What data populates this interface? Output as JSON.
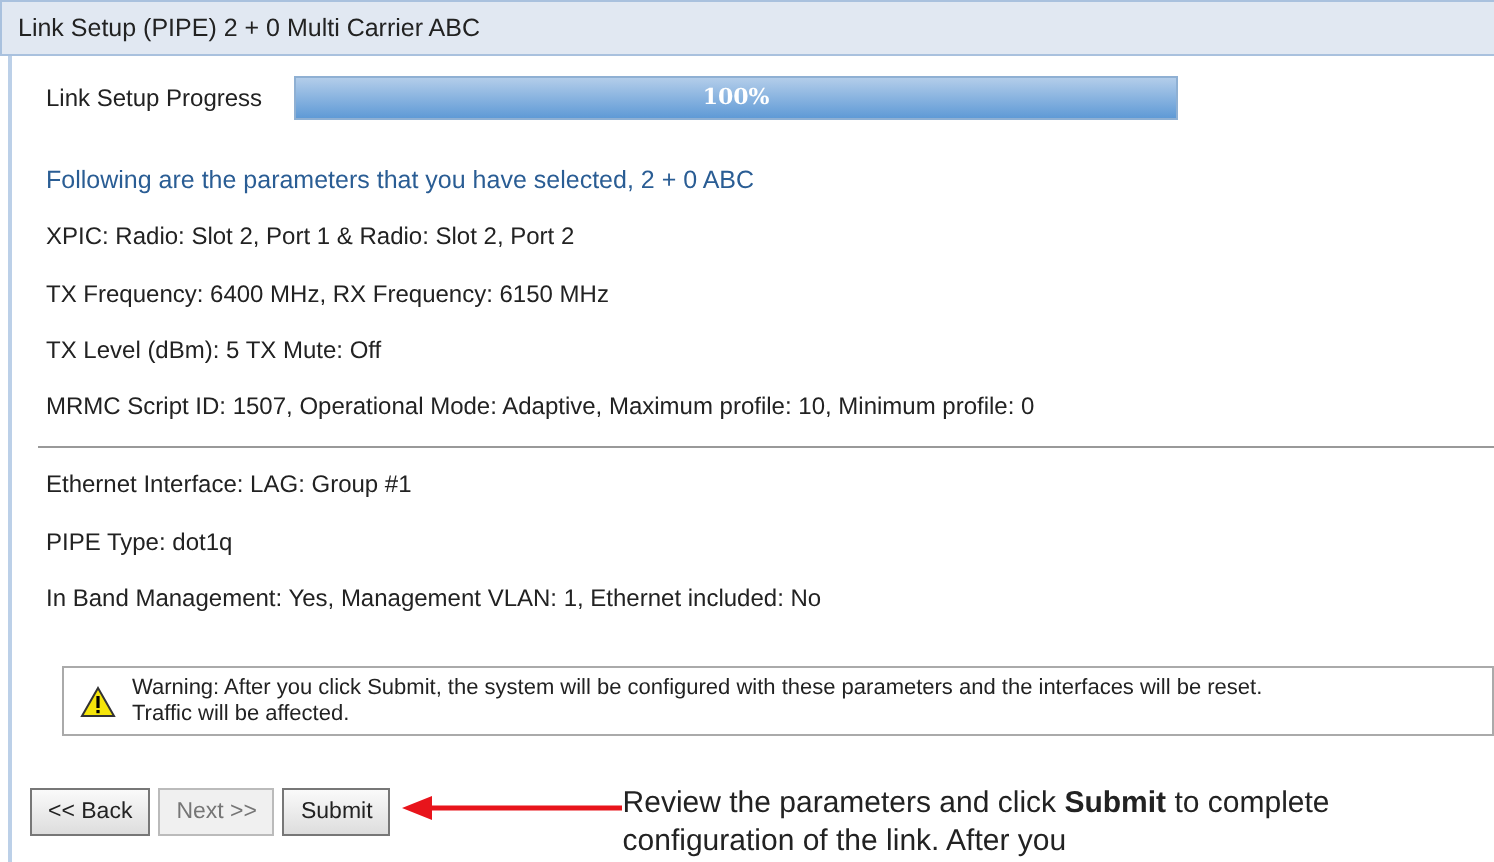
{
  "window": {
    "title": "Link Setup (PIPE) 2 + 0 Multi Carrier ABC"
  },
  "progress": {
    "label": "Link Setup Progress",
    "level": 1.0,
    "reading": "100%"
  },
  "summary_heading": "Following are the parameters that you have selected, 2 + 0 ABC",
  "parameters": [
    "XPIC: Radio: Slot 2, Port 1 & Radio: Slot 2, Port 2",
    "TX Frequency: 6400 MHz, RX Frequency: 6150 MHz",
    "TX Level (dBm): 5 TX Mute: Off",
    "MRMC Script ID: 1507, Operational Mode: Adaptive, Maximum profile: 10, Minimum profile: 0"
  ],
  "ethernet_parameters": [
    "Ethernet Interface: LAG: Group #1",
    "PIPE Type: dot1q",
    "In Band Management: Yes, Management VLAN: 1, Ethernet included: No"
  ],
  "warning": {
    "lines": [
      "Warning: After you click Submit, the system will be configured with these parameters and the interfaces will be reset.",
      "Traffic will be affected."
    ]
  },
  "buttons": [
    {
      "label": "<< Back",
      "disabled": false
    },
    {
      "label": "Next >>",
      "disabled": true
    },
    {
      "label": "Submit",
      "disabled": false
    }
  ],
  "callout": {
    "text": "Review the parameters and click **Submit** to complete configuration of the link. After you"
  }
}
